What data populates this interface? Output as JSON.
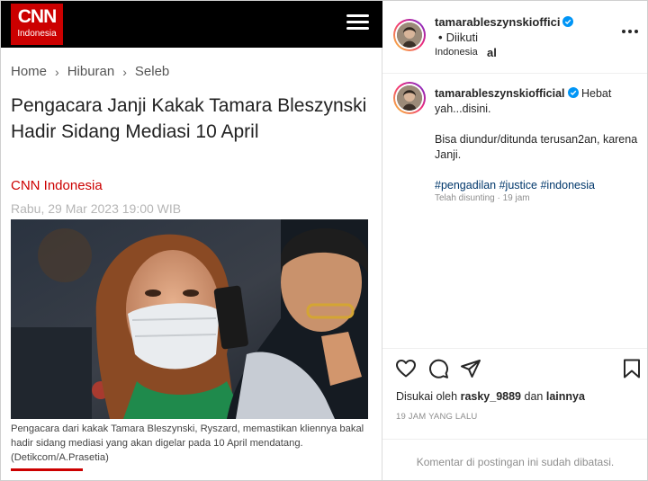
{
  "article": {
    "logo": {
      "mark": "CNN",
      "sub": "Indonesia"
    },
    "breadcrumb": [
      "Home",
      "Hiburan",
      "Seleb"
    ],
    "breadcrumb_sep": "›",
    "headline": "Pengacara Janji Kakak Tamara Bleszynski Hadir Sidang Mediasi 10 April",
    "source": "CNN Indonesia",
    "date": "Rabu, 29 Mar 2023 19:00 WIB",
    "caption": "Pengacara dari kakak Tamara Bleszynski, Ryszard, memastikan kliennya bakal hadir sidang mediasi yang akan digelar pada 10 April mendatang. (Detikcom/A.Prasetia)",
    "colors": {
      "brand": "#cc0000",
      "header": "#000000"
    }
  },
  "instagram": {
    "username": "tamarableszynskiofficial",
    "header_user_line1": "tamarableszynskioffici",
    "header_user_line2": "al",
    "follow_label": "Diikuti",
    "dot": "•",
    "location": "Indonesia",
    "comment": {
      "username": "tamarableszynskiofficial",
      "line1": "Hebat yah...disini.",
      "line2": "Bisa diundur/ditunda terusan2an, karena Janji.",
      "hashtags": [
        "#pengadilan",
        "#justice",
        "#indonesia"
      ]
    },
    "edited": "Telah disunting · 19 jam",
    "likes_prefix": "Disukai oleh",
    "likes_user": "rasky_9889",
    "likes_and": "dan",
    "likes_others": "lainnya",
    "time_ago": "19 JAM YANG LALU",
    "comments_disabled": "Komentar di postingan ini sudah dibatasi.",
    "icons": [
      "heart-icon",
      "comment-icon",
      "share-icon",
      "bookmark-icon",
      "more-options-icon",
      "verified-badge-icon"
    ],
    "colors": {
      "verified": "#0095f6",
      "hashtag": "#00376b",
      "muted": "#8e8e8e"
    }
  }
}
